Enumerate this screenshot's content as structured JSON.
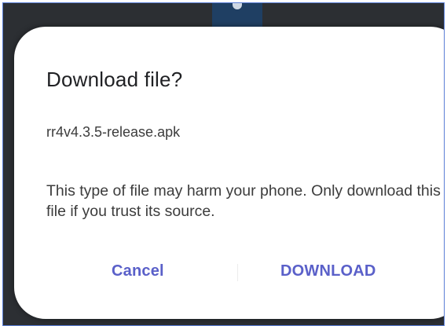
{
  "dialog": {
    "title": "Download file?",
    "filename": "rr4v4.3.5-release.apk",
    "message": "This type of file may harm your phone. Only download this file if you trust its source.",
    "cancel_label": "Cancel",
    "download_label": "DOWNLOAD"
  },
  "colors": {
    "accent": "#5a60c9",
    "backdrop": "#2c2f33",
    "dialog_bg": "#ffffff"
  }
}
